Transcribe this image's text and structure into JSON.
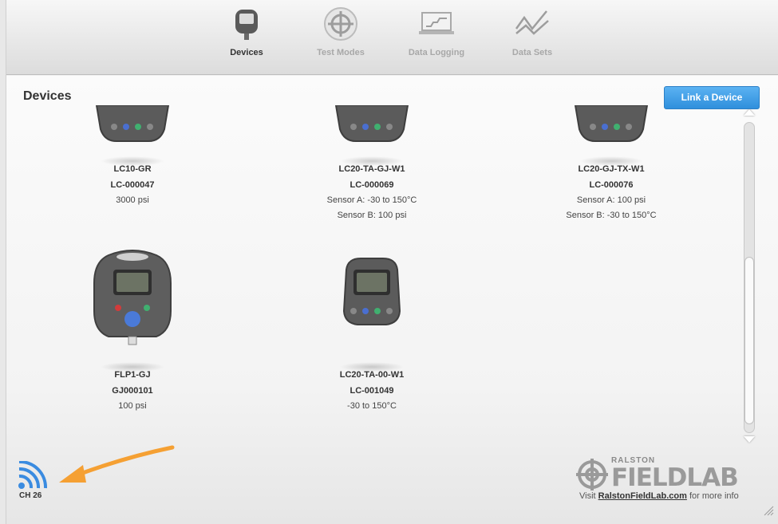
{
  "toolbar": {
    "items": [
      {
        "label": "Devices",
        "icon": "device-icon",
        "active": true
      },
      {
        "label": "Test Modes",
        "icon": "crosshair-icon",
        "active": false
      },
      {
        "label": "Data Logging",
        "icon": "laptop-chart-icon",
        "active": false
      },
      {
        "label": "Data Sets",
        "icon": "line-chart-icon",
        "active": false
      }
    ]
  },
  "main": {
    "title": "Devices",
    "link_button": "Link a Device"
  },
  "devices": [
    {
      "model": "LC10-GR",
      "serial": "LC-000047",
      "lines": [
        "3000 psi"
      ]
    },
    {
      "model": "LC20-TA-GJ-W1",
      "serial": "LC-000069",
      "lines": [
        "Sensor A: -30 to 150°C",
        "Sensor B: 100 psi"
      ]
    },
    {
      "model": "LC20-GJ-TX-W1",
      "serial": "LC-000076",
      "lines": [
        "Sensor A: 100 psi",
        "Sensor B: -30 to 150°C"
      ]
    },
    {
      "model": "FLP1-GJ",
      "serial": "GJ000101",
      "lines": [
        "100 psi"
      ]
    },
    {
      "model": "LC20-TA-00-W1",
      "serial": "LC-001049",
      "lines": [
        "-30 to 150°C"
      ]
    }
  ],
  "status": {
    "channel": "CH 26"
  },
  "footer": {
    "brand_top": "RALSTON",
    "brand_main": "FIELDLAB",
    "visit_prefix": "Visit ",
    "url": "RalstonFieldLab.com",
    "visit_suffix": " for more info"
  },
  "colors": {
    "accent": "#3a9be6",
    "annotation_arrow": "#f5a033"
  }
}
